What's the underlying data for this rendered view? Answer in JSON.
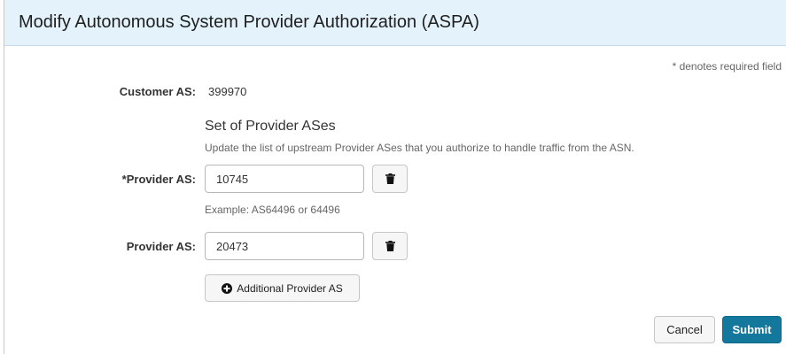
{
  "modal": {
    "title": "Modify Autonomous System Provider Authorization (ASPA)",
    "required_note": "* denotes required field"
  },
  "customer": {
    "label": "Customer AS:",
    "value": "399970"
  },
  "provider_section": {
    "title": "Set of Provider ASes",
    "description": "Update the list of upstream Provider ASes that you authorize to handle traffic from the ASN.",
    "help_text": "Example: AS64496 or 64496",
    "providers": [
      {
        "label": "*Provider AS:",
        "value": "10745",
        "delete_icon": "trash-icon"
      },
      {
        "label": "Provider AS:",
        "value": "20473",
        "delete_icon": "trash-icon"
      }
    ],
    "add_button_label": "Additional Provider AS",
    "add_button_icon": "plus-circle-icon"
  },
  "actions": {
    "cancel_label": "Cancel",
    "submit_label": "Submit",
    "submit_color": "#13789c"
  }
}
